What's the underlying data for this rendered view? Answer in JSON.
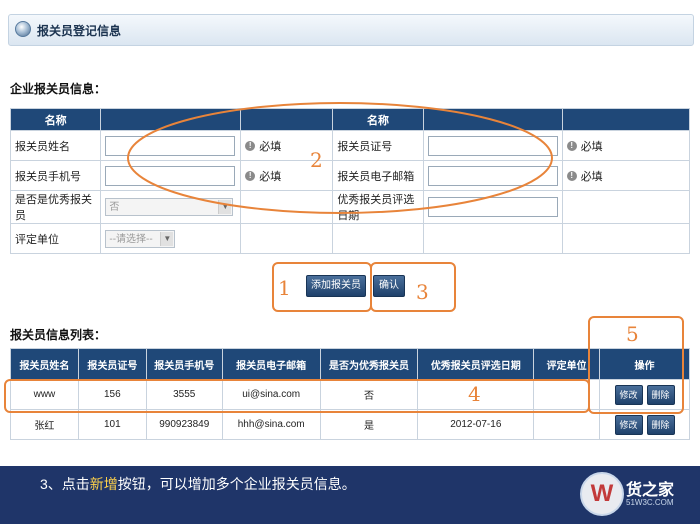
{
  "window": {
    "title": "报关员登记信息"
  },
  "form": {
    "section_title": "企业报关员信息：",
    "header": [
      "名称",
      "名称"
    ],
    "rows": [
      {
        "label1": "报关员姓名",
        "label2": "报关员证号",
        "req": "必填"
      },
      {
        "label1": "报关员手机号",
        "label2": "报关员电子邮箱",
        "req": "必填"
      },
      {
        "label1": "是否是优秀报关员",
        "select1": "否",
        "label2": "优秀报关员评选日期"
      },
      {
        "label1": "评定单位",
        "select1": "--请选择--"
      }
    ],
    "add_button": "添加报关员",
    "confirm_button": "确认"
  },
  "list": {
    "section_title": "报关员信息列表：",
    "columns": [
      "报关员姓名",
      "报关员证号",
      "报关员手机号",
      "报关员电子邮箱",
      "是否为优秀报关员",
      "优秀报关员评选日期",
      "评定单位",
      "操作"
    ],
    "rows": [
      {
        "name": "www",
        "cert": "156",
        "phone": "3555",
        "email": "ui@sina.com",
        "excellent": "否",
        "date": "",
        "unit": "",
        "edit": "修改",
        "delete": "删除"
      },
      {
        "name": "张红",
        "cert": "101",
        "phone": "990923849",
        "email": "hhh@sina.com",
        "excellent": "是",
        "date": "2012-07-16",
        "unit": "",
        "edit": "修改",
        "delete": "删除"
      }
    ]
  },
  "annotations": {
    "n1": "1",
    "n2": "2",
    "n3": "3",
    "n4": "4",
    "n5": "5"
  },
  "caption": {
    "prefix": "3、点击",
    "highlight": "新增",
    "suffix": "按钮，可以增加多个企业报关员信息。"
  },
  "logo": {
    "mark": "W",
    "text": "货之家",
    "url": "51W3C.COM"
  },
  "colors": {
    "header_blue": "#1f4878",
    "annotation_orange": "#e8843a",
    "footer_navy": "#1f3569"
  }
}
